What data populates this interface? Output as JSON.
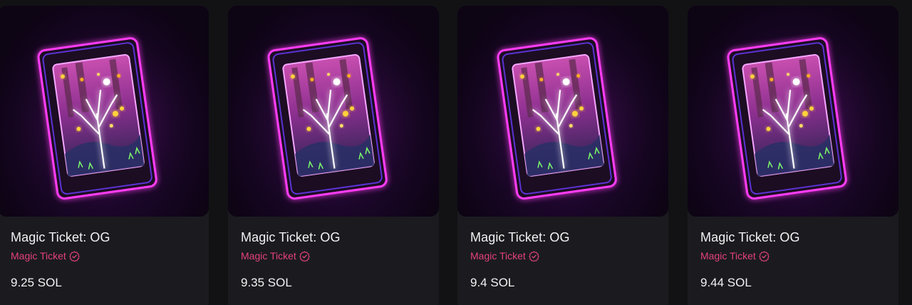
{
  "listings": [
    {
      "title": "Magic Ticket: OG",
      "collection": "Magic Ticket",
      "price": "9.25 SOL",
      "image_icon": "magic-ticket-nft-image",
      "verified_icon": "verified-badge-icon"
    },
    {
      "title": "Magic Ticket: OG",
      "collection": "Magic Ticket",
      "price": "9.35 SOL",
      "image_icon": "magic-ticket-nft-image",
      "verified_icon": "verified-badge-icon"
    },
    {
      "title": "Magic Ticket: OG",
      "collection": "Magic Ticket",
      "price": "9.4 SOL",
      "image_icon": "magic-ticket-nft-image",
      "verified_icon": "verified-badge-icon"
    },
    {
      "title": "Magic Ticket: OG",
      "collection": "Magic Ticket",
      "price": "9.44 SOL",
      "image_icon": "magic-ticket-nft-image",
      "verified_icon": "verified-badge-icon"
    }
  ],
  "colors": {
    "background": "#121214",
    "card": "#1b1b1f",
    "collection_accent": "#e4417a",
    "text": "#f2f2f4",
    "neon_frame": "#ff3df5"
  }
}
